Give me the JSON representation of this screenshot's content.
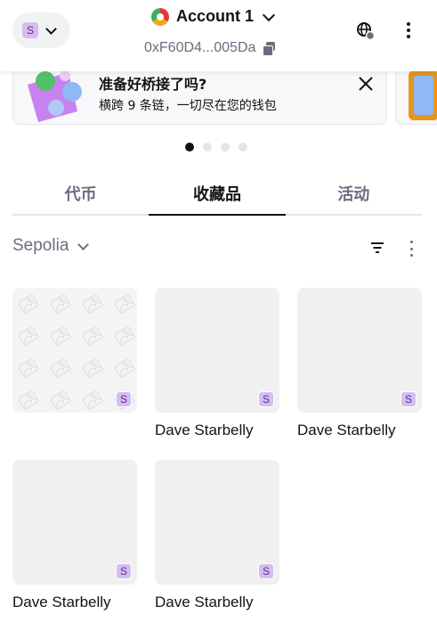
{
  "header": {
    "network_badge": "S",
    "account_name": "Account 1",
    "address": "0xF60D4...005Da"
  },
  "banner": {
    "title": "准备好桥接了吗?",
    "subtitle": "横跨 9 条链，一切尽在您的钱包"
  },
  "tabs": [
    {
      "label": "代币",
      "active": false
    },
    {
      "label": "收藏品",
      "active": true
    },
    {
      "label": "活动",
      "active": false
    }
  ],
  "filter": {
    "network": "Sepolia"
  },
  "nfts": [
    {
      "name": "",
      "badge": "S",
      "placeholder": true
    },
    {
      "name": "Dave Starbelly",
      "badge": "S"
    },
    {
      "name": "Dave Starbelly",
      "badge": "S"
    },
    {
      "name": "Dave Starbelly",
      "badge": "S"
    },
    {
      "name": "Dave Starbelly",
      "badge": "S"
    }
  ],
  "colors": {
    "text": "#121314",
    "muted": "#686e7d",
    "badge_bg": "#d5bdf2",
    "divider": "#e3e5e9"
  }
}
